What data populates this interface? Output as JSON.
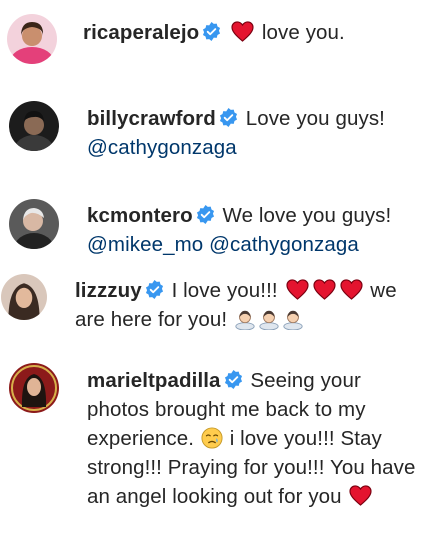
{
  "comments": [
    {
      "username": "ricaperalejo",
      "parts": [
        "love you."
      ],
      "avatar_color": "#d63c74"
    },
    {
      "username": "billycrawford",
      "parts": [
        "Love you guys!",
        "@cathygonzaga"
      ],
      "avatar_color": "#2b2b2b"
    },
    {
      "username": "kcmontero",
      "parts": [
        "We love you guys!",
        "@mikee_mo",
        "@cathygonzaga"
      ],
      "avatar_color": "#444444"
    },
    {
      "username": "lizzzuy",
      "parts": [
        "I love you!!!",
        "we",
        "are here for you!"
      ],
      "avatar_color": "#4a3a33"
    },
    {
      "username": "marieltpadilla",
      "parts": [
        "Seeing your",
        "photos brought me back to my",
        "experience.",
        "i love you!!! Stay",
        "strong!!! Praying for you!!! You have",
        "an angel looking out for you"
      ],
      "avatar_color": "#7a1a1a"
    }
  ],
  "icons": {
    "verified": "verified-badge-icon",
    "heart": "red-heart-icon",
    "pray": "bowing-person-emoji",
    "sad": "sad-relieved-face-emoji"
  },
  "colors": {
    "verified": "#3897f0",
    "heart": "#e4142f",
    "mention": "#00376b",
    "text": "#262626"
  }
}
